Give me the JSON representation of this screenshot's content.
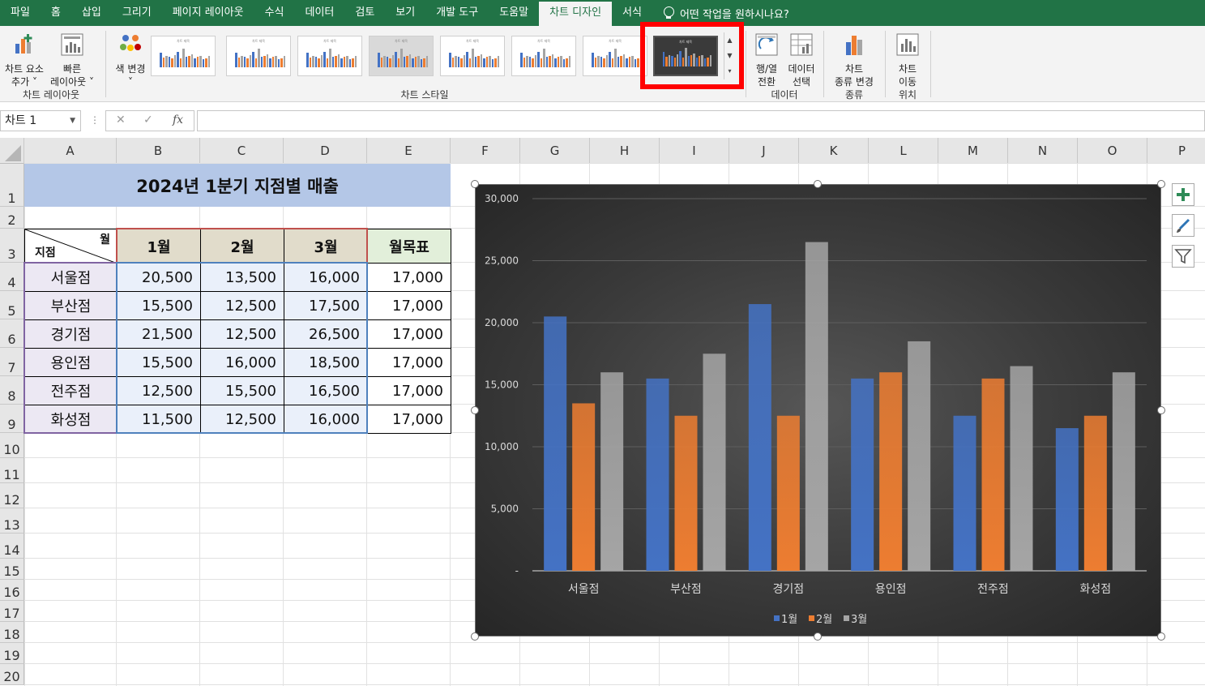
{
  "ribbon_tabs": [
    "파일",
    "홈",
    "삽입",
    "그리기",
    "페이지 레이아웃",
    "수식",
    "데이터",
    "검토",
    "보기",
    "개발 도구",
    "도움말",
    "차트 디자인",
    "서식"
  ],
  "active_tab_index": 11,
  "tell_me": "어떤 작업을 원하시나요?",
  "ribbon": {
    "add_element_line1": "차트 요소",
    "add_element_line2": "추가 ˅",
    "quick_layout_line1": "빠른",
    "quick_layout_line2": "레이아웃 ˅",
    "group_layout": "차트 레이아웃",
    "change_color_line1": "색 변경",
    "change_color_line2": "˅",
    "group_styles": "차트 스타일",
    "switch_row_col_line1": "행/열",
    "switch_row_col_line2": "전환",
    "select_data_line1": "데이터",
    "select_data_line2": "선택",
    "group_data": "데이터",
    "change_type_line1": "차트",
    "change_type_line2": "종류 변경",
    "group_type": "종류",
    "move_chart_line1": "차트",
    "move_chart_line2": "이동",
    "group_location": "위치",
    "thumb_title": "차트 제목"
  },
  "name_box": "차트 1",
  "columns": [
    "A",
    "B",
    "C",
    "D",
    "E",
    "F",
    "G",
    "H",
    "I",
    "J",
    "K",
    "L",
    "M",
    "N",
    "O",
    "P"
  ],
  "rows": [
    "1",
    "2",
    "3",
    "4",
    "5",
    "6",
    "7",
    "8",
    "9",
    "10",
    "11",
    "12",
    "13",
    "14",
    "15",
    "16",
    "17",
    "18",
    "19",
    "20"
  ],
  "sheet": {
    "title": "2024년 1분기 지점별 매출",
    "corner_top": "월",
    "corner_bottom": "지점",
    "headers": [
      "1월",
      "2월",
      "3월",
      "월목표"
    ],
    "table": [
      {
        "name": "서울점",
        "v": [
          "20,500",
          "13,500",
          "16,000",
          "17,000"
        ]
      },
      {
        "name": "부산점",
        "v": [
          "15,500",
          "12,500",
          "17,500",
          "17,000"
        ]
      },
      {
        "name": "경기점",
        "v": [
          "21,500",
          "12,500",
          "26,500",
          "17,000"
        ]
      },
      {
        "name": "용인점",
        "v": [
          "15,500",
          "16,000",
          "18,500",
          "17,000"
        ]
      },
      {
        "name": "전주점",
        "v": [
          "12,500",
          "15,500",
          "16,500",
          "17,000"
        ]
      },
      {
        "name": "화성점",
        "v": [
          "11,500",
          "12,500",
          "16,000",
          "17,000"
        ]
      }
    ]
  },
  "chart_data": {
    "type": "bar",
    "categories": [
      "서울점",
      "부산점",
      "경기점",
      "용인점",
      "전주점",
      "화성점"
    ],
    "series": [
      {
        "name": "1월",
        "values": [
          20500,
          15500,
          21500,
          15500,
          12500,
          11500
        ],
        "color": "#4472c4"
      },
      {
        "name": "2월",
        "values": [
          13500,
          12500,
          12500,
          16000,
          15500,
          12500
        ],
        "color": "#ed7d31"
      },
      {
        "name": "3월",
        "values": [
          16000,
          17500,
          26500,
          18500,
          16500,
          16000
        ],
        "color": "#a5a5a5"
      }
    ],
    "ylim": [
      0,
      30000
    ],
    "y_ticks": [
      "-",
      "5,000",
      "10,000",
      "15,000",
      "20,000",
      "25,000",
      "30,000"
    ],
    "legend": "bottom",
    "grid": true,
    "title": "",
    "xlabel": "",
    "ylabel": ""
  }
}
